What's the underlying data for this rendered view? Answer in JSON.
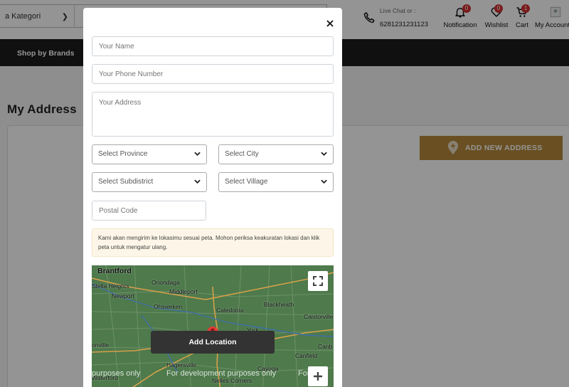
{
  "header": {
    "category_select": "a Kategori",
    "live_chat_label": "Live Chat or :",
    "live_chat_number": "6281231231123",
    "notification": {
      "label": "Notification",
      "count": "0"
    },
    "wishlist": {
      "label": "Wishlist",
      "count": "0"
    },
    "cart": {
      "label": "Cart",
      "count": "1"
    },
    "account": {
      "label": "My Account"
    }
  },
  "navbar": {
    "shop_by_brands": "Shop by Brands"
  },
  "page": {
    "title": "My Address",
    "add_new_address": "ADD NEW ADDRESS",
    "accent_color": "#b5893b"
  },
  "modal": {
    "name_placeholder": "Your Name",
    "phone_placeholder": "Your Phone Number",
    "address_placeholder": "Your Address",
    "province": "Select Province",
    "city": "Select City",
    "subdistrict": "Select Subdistrict",
    "village": "Select Village",
    "postal_placeholder": "Postal Code",
    "notice": "Kami akan mengirim ke lokasimu sesuai peta. Mohon periksa keakuratan lokasi dan klik peta untuk mengatur ulang.",
    "map": {
      "places": [
        "Brantford",
        "Onondaga",
        "Middleport",
        "Stella Heights",
        "Newport",
        "Ohsweken",
        "Caledonia",
        "Blackheath",
        "Caistorville",
        "York",
        "Canfield",
        "Hagersville",
        "Cayuga",
        "Nelles Corners",
        "Waterford",
        "onville",
        "Canb"
      ],
      "dev_text_1": "purposes only",
      "dev_text_2": "For development purposes only",
      "dev_text_3": "For de",
      "add_location": "Add Location",
      "fullscreen_icon": "fullscreen-icon",
      "zoom_in_icon": "plus-icon"
    }
  }
}
